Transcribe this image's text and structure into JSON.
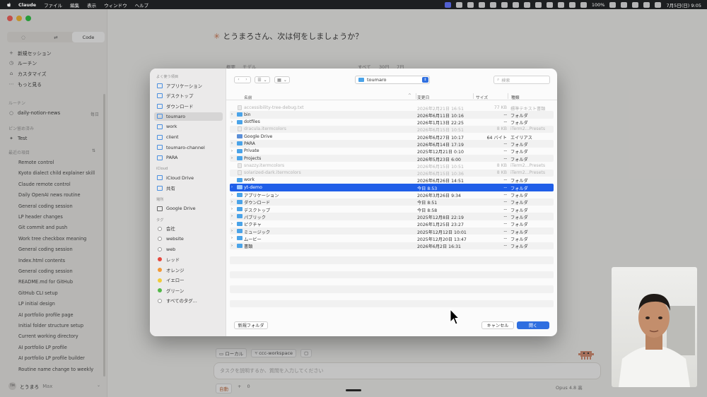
{
  "menubar": {
    "app_name": "Claude",
    "menus": [
      "ファイル",
      "編集",
      "表示",
      "ウィンドウ",
      "ヘルプ"
    ],
    "battery": "100%",
    "datetime": "7月5日(日)  9:05"
  },
  "app": {
    "tabs": [
      "",
      "",
      "Code"
    ],
    "nav": [
      {
        "icon": "+",
        "label": "新規セッション"
      },
      {
        "icon": "◷",
        "label": "ルーチン"
      },
      {
        "icon": "⌂",
        "label": "カスタマイズ"
      },
      {
        "icon": "⋯",
        "label": "もっと見る"
      }
    ],
    "routines_header": "ルーチン",
    "routine_item": "daily-notion-news",
    "routine_schedule": "毎日",
    "pinned_header": "ピン留め済み",
    "pinned_item": "Test",
    "recent_header": "最近の項目",
    "recent_items": [
      "Remote control",
      "Kyoto dialect child explainer skill",
      "Claude remote control",
      "Daily OpenAI news routine",
      "General coding session",
      "LP header changes",
      "Git commit and push",
      "Work tree checkbox meaning",
      "General coding session",
      "Index.html contents",
      "General coding session",
      "README.md for GitHub",
      "GitHub CLI setup",
      "LP initial design",
      "AI portfolio profile page",
      "Initial folder structure setup",
      "Current working directory",
      "AI portfolio LP profile",
      "AI portfolio LP profile builder",
      "Routine name change to weekly"
    ],
    "user_initials": "TM",
    "user_name": "とうまろ",
    "user_plan": "Max",
    "greeting": "とうまろさん、次は何をしましょうか？",
    "behind_labels": {
      "a": "概要",
      "b": "モデル",
      "c": "すべて",
      "d": "30日",
      "e": "7日"
    },
    "chips": [
      "ローカル",
      "ccc-workspace"
    ],
    "prompt_placeholder": "タスクを説明するか、質問を入力してください",
    "mode_label": "自動",
    "plus": "+",
    "zero": "0",
    "model_label": "Opus 4.8",
    "model_suffix": "高"
  },
  "dialog": {
    "sidebar": {
      "favorites_header": "よく使う項目",
      "favorites": [
        {
          "label": "アプリケーション",
          "icon": "apps-icon"
        },
        {
          "label": "デスクトップ",
          "icon": "desktop-icon"
        },
        {
          "label": "ダウンロード",
          "icon": "download-icon"
        },
        {
          "label": "toumaro",
          "icon": "home-icon",
          "selected": true
        },
        {
          "label": "work",
          "icon": "folder-icon"
        },
        {
          "label": "client",
          "icon": "folder-icon"
        },
        {
          "label": "toumaro-channel",
          "icon": "folder-icon"
        },
        {
          "label": "PARA",
          "icon": "folder-icon"
        }
      ],
      "icloud_header": "iCloud",
      "icloud": [
        {
          "label": "iCloud Drive",
          "icon": "cloud-icon"
        },
        {
          "label": "共有",
          "icon": "shared-folder-icon"
        }
      ],
      "locations_header": "場所",
      "locations": [
        {
          "label": "Google Drive",
          "icon": "drive-icon"
        }
      ],
      "tags_header": "タグ",
      "tags": [
        {
          "label": "会社",
          "color": "#ffffff"
        },
        {
          "label": "website",
          "color": "#ffffff"
        },
        {
          "label": "web",
          "color": "#ffffff"
        },
        {
          "label": "レッド",
          "color": "#e5483d"
        },
        {
          "label": "オレンジ",
          "color": "#f19a38"
        },
        {
          "label": "イエロー",
          "color": "#f2cb3a"
        },
        {
          "label": "グリーン",
          "color": "#52b748"
        },
        {
          "label": "すべてのタグ...",
          "color": "all"
        }
      ]
    },
    "toolbar": {
      "current_folder": "toumaro",
      "search_placeholder": "検索"
    },
    "columns": {
      "name": "名前",
      "date": "変更日",
      "size": "サイズ",
      "kind": "種類"
    },
    "files": [
      {
        "name": "accessibility-tree-debug.txt",
        "date": "2026年2月21日 16:51",
        "size": "77 KB",
        "kind": "標準テキスト書類",
        "type": "file",
        "disabled": true,
        "expandable": false
      },
      {
        "name": "bin",
        "date": "2026年6月11日 10:16",
        "size": "--",
        "kind": "フォルダ",
        "type": "folder",
        "disabled": false,
        "expandable": true
      },
      {
        "name": "dotfiles",
        "date": "2026年1月13日 22:25",
        "size": "--",
        "kind": "フォルダ",
        "type": "folder",
        "disabled": false,
        "expandable": true
      },
      {
        "name": "dracula.itermcolors",
        "date": "2026年6月15日 10:51",
        "size": "8 KB",
        "kind": "iTerm2...Presets",
        "type": "file",
        "disabled": true,
        "expandable": false
      },
      {
        "name": "Google Drive",
        "date": "2026年6月27日 10:17",
        "size": "64 バイト",
        "kind": "エイリアス",
        "type": "symlink",
        "disabled": false,
        "expandable": false
      },
      {
        "name": "PARA",
        "date": "2026年6月14日 17:19",
        "size": "--",
        "kind": "フォルダ",
        "type": "folder",
        "disabled": false,
        "expandable": true
      },
      {
        "name": "Private",
        "date": "2025年12月21日 0:10",
        "size": "--",
        "kind": "フォルダ",
        "type": "folder",
        "disabled": false,
        "expandable": true
      },
      {
        "name": "Projects",
        "date": "2026年5月23日 6:00",
        "size": "--",
        "kind": "フォルダ",
        "type": "folder",
        "disabled": false,
        "expandable": true
      },
      {
        "name": "snazzy.itermcolors",
        "date": "2026年6月15日 10:51",
        "size": "8 KB",
        "kind": "iTerm2...Presets",
        "type": "file",
        "disabled": true,
        "expandable": false
      },
      {
        "name": "solarized-dark.itermcolors",
        "date": "2026年6月15日 10:36",
        "size": "8 KB",
        "kind": "iTerm2...Presets",
        "type": "file",
        "disabled": true,
        "expandable": false
      },
      {
        "name": "work",
        "date": "2026年6月26日 14:51",
        "size": "--",
        "kind": "フォルダ",
        "type": "folder",
        "disabled": false,
        "expandable": false
      },
      {
        "name": "yt-demo",
        "date": "今日 8:53",
        "size": "--",
        "kind": "フォルダ",
        "type": "folder",
        "disabled": false,
        "expandable": true,
        "selected": true
      },
      {
        "name": "アプリケーション",
        "date": "2026年3月26日 9:34",
        "size": "--",
        "kind": "フォルダ",
        "type": "folder",
        "disabled": false,
        "expandable": true
      },
      {
        "name": "ダウンロード",
        "date": "今日 8:51",
        "size": "--",
        "kind": "フォルダ",
        "type": "folder",
        "disabled": false,
        "expandable": true
      },
      {
        "name": "デスクトップ",
        "date": "今日 8:58",
        "size": "--",
        "kind": "フォルダ",
        "type": "folder",
        "disabled": false,
        "expandable": true
      },
      {
        "name": "パブリック",
        "date": "2025年12月8日 22:19",
        "size": "--",
        "kind": "フォルダ",
        "type": "folder",
        "disabled": false,
        "expandable": true
      },
      {
        "name": "ピクチャ",
        "date": "2026年1月25日 23:27",
        "size": "--",
        "kind": "フォルダ",
        "type": "folder",
        "disabled": false,
        "expandable": true
      },
      {
        "name": "ミュージック",
        "date": "2025年12月12日 10:01",
        "size": "--",
        "kind": "フォルダ",
        "type": "folder",
        "disabled": false,
        "expandable": true
      },
      {
        "name": "ムービー",
        "date": "2025年12月20日 13:47",
        "size": "--",
        "kind": "フォルダ",
        "type": "folder",
        "disabled": false,
        "expandable": true
      },
      {
        "name": "書類",
        "date": "2026年6月2日 16:31",
        "size": "--",
        "kind": "フォルダ",
        "type": "folder",
        "disabled": false,
        "expandable": true
      }
    ],
    "buttons": {
      "new_folder": "新規フォルダ",
      "cancel": "キャンセル",
      "open": "開く"
    }
  }
}
